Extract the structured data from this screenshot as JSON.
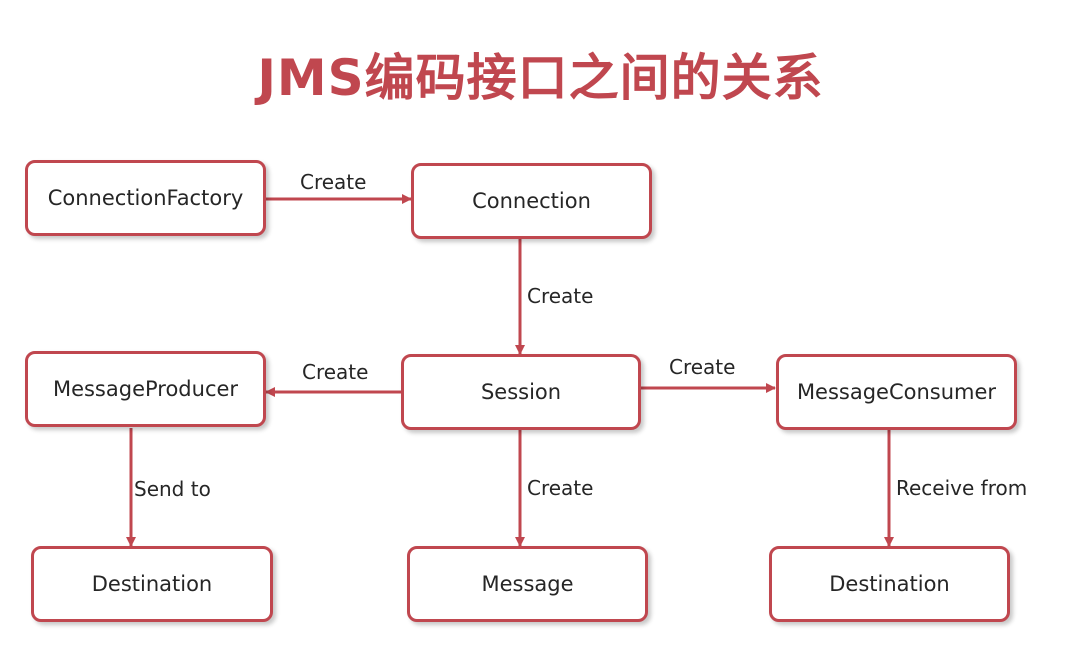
{
  "title": "JMS编码接口之间的关系",
  "colors": {
    "accent": "#c0474f",
    "text": "#262626",
    "background": "#ffffff"
  },
  "nodes": {
    "connection_factory": "ConnectionFactory",
    "connection": "Connection",
    "session": "Session",
    "message_producer": "MessageProducer",
    "message_consumer": "MessageConsumer",
    "destination_send": "Destination",
    "message": "Message",
    "destination_receive": "Destination"
  },
  "edges": {
    "factory_to_connection": "Create",
    "connection_to_session": "Create",
    "session_to_producer": "Create",
    "session_to_consumer": "Create",
    "session_to_message": "Create",
    "producer_to_destination": "Send to",
    "consumer_to_destination": "Receive from"
  }
}
